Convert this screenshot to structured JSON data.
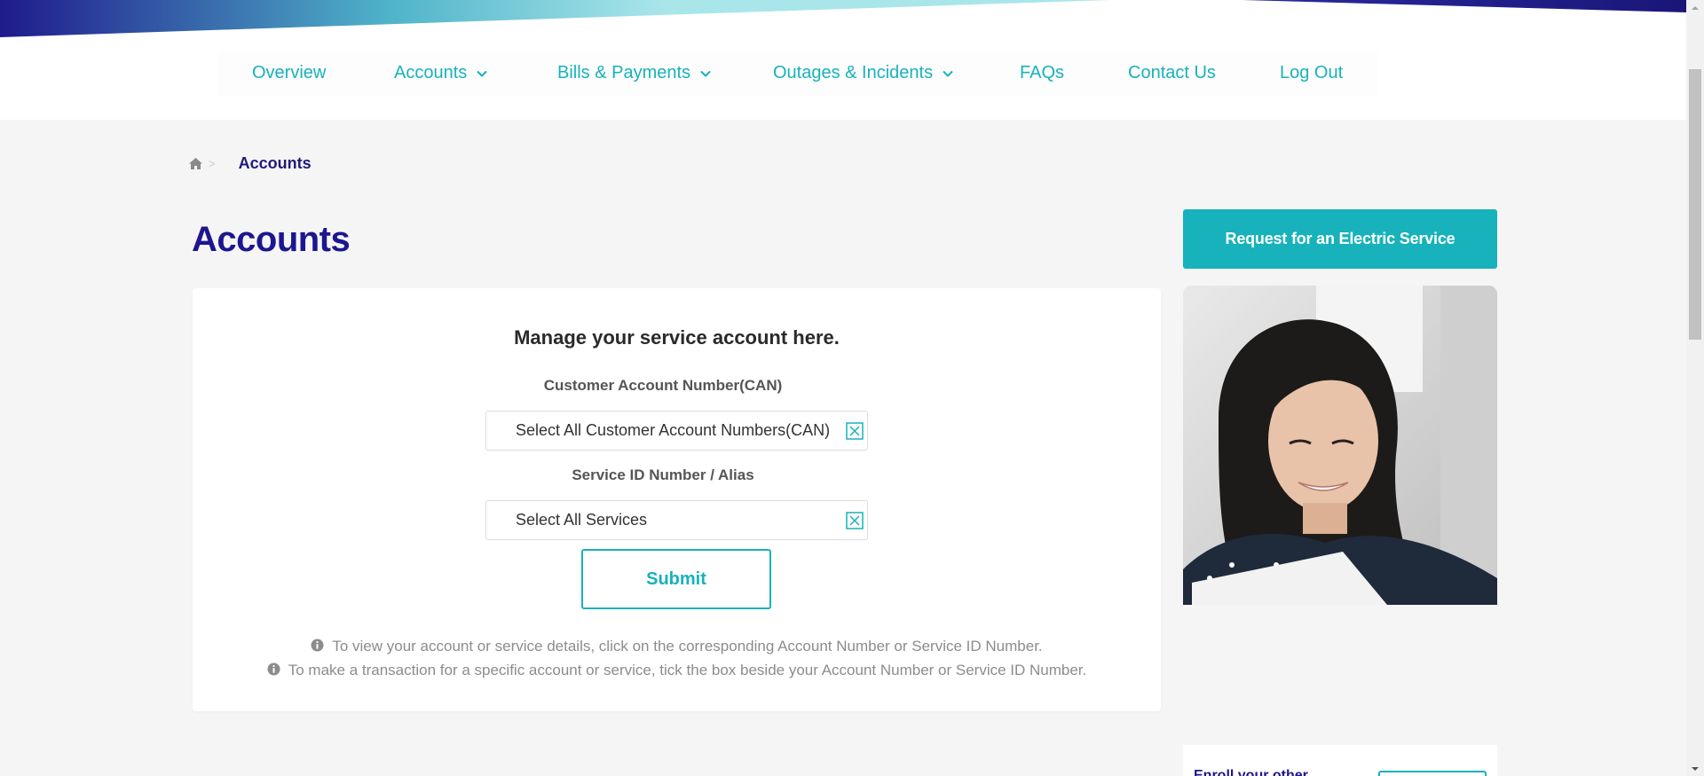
{
  "nav": {
    "items": [
      {
        "label": "Overview",
        "has_dropdown": false
      },
      {
        "label": "Accounts",
        "has_dropdown": true
      },
      {
        "label": "Bills & Payments",
        "has_dropdown": true
      },
      {
        "label": "Outages & Incidents",
        "has_dropdown": true
      },
      {
        "label": "FAQs",
        "has_dropdown": false
      },
      {
        "label": "Contact Us",
        "has_dropdown": false
      },
      {
        "label": "Log Out",
        "has_dropdown": false
      }
    ]
  },
  "breadcrumb": {
    "separator": ">",
    "current": "Accounts"
  },
  "page": {
    "title": "Accounts"
  },
  "card": {
    "heading": "Manage your service account here.",
    "can_label": "Customer Account Number(CAN)",
    "can_value": "Select All Customer Account Numbers(CAN)",
    "service_label": "Service ID Number / Alias",
    "service_value": "Select All Services",
    "submit_label": "Submit",
    "info_1": "To view your account or service details, click on the corresponding Account Number or Service ID Number.",
    "info_2": "To make a transaction for a specific account or service, tick the box beside your Account Number or Service ID Number."
  },
  "sidebar": {
    "request_button": "Request for an Electric Service",
    "enroll_text": "Enroll your other"
  },
  "colors": {
    "accent": "#17b2bb",
    "brand_navy": "#1d168f",
    "background": "#f5f5f5"
  }
}
